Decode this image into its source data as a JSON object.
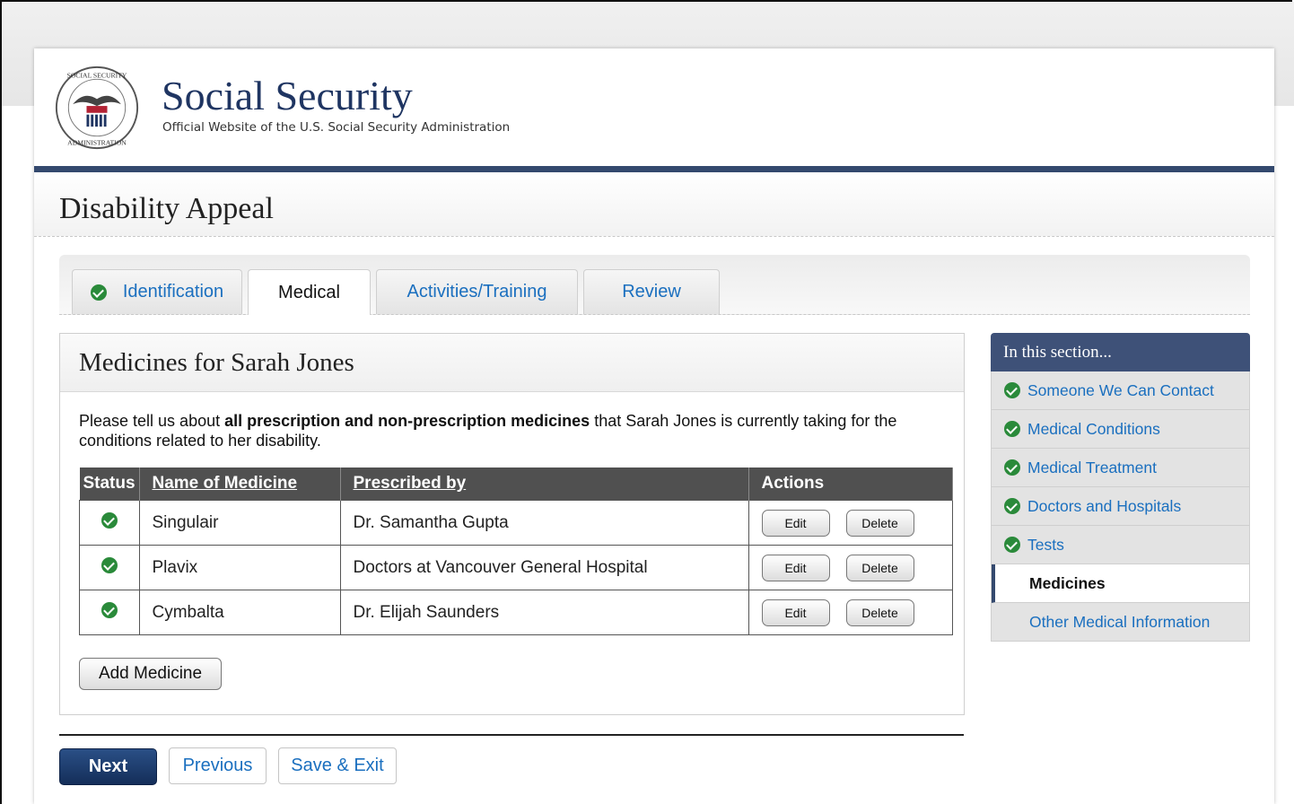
{
  "brand": {
    "title": "Social Security",
    "subtitle": "Official Website of the U.S. Social Security Administration"
  },
  "page_title": "Disability Appeal",
  "tabs": [
    {
      "label": "Identification",
      "complete": true
    },
    {
      "label": "Medical",
      "active": true
    },
    {
      "label": "Activities/Training"
    },
    {
      "label": "Review"
    }
  ],
  "panel": {
    "title": "Medicines for Sarah Jones",
    "intro_pre": "Please tell us about ",
    "intro_bold": "all prescription and non-prescription medicines",
    "intro_post": " that Sarah Jones is currently taking for the conditions related to her disability."
  },
  "table": {
    "headers": {
      "status": "Status",
      "name": "Name of Medicine",
      "prescriber": "Prescribed by",
      "actions": "Actions"
    },
    "rows": [
      {
        "name": "Singulair",
        "prescriber": "Dr. Samantha Gupta"
      },
      {
        "name": "Plavix",
        "prescriber": "Doctors at Vancouver General Hospital"
      },
      {
        "name": "Cymbalta",
        "prescriber": "Dr. Elijah Saunders"
      }
    ],
    "edit_label": "Edit",
    "delete_label": "Delete"
  },
  "add_medicine_label": "Add Medicine",
  "nav_buttons": {
    "next": "Next",
    "previous": "Previous",
    "save_exit": "Save & Exit"
  },
  "sidebar": {
    "heading": "In this section...",
    "items": [
      {
        "label": "Someone We Can Contact",
        "complete": true
      },
      {
        "label": "Medical Conditions",
        "complete": true
      },
      {
        "label": "Medical Treatment",
        "complete": true
      },
      {
        "label": "Doctors and Hospitals",
        "complete": true
      },
      {
        "label": "Tests",
        "complete": true
      },
      {
        "label": "Medicines",
        "current": true
      },
      {
        "label": "Other Medical Information"
      }
    ]
  },
  "colors": {
    "navy": "#34496e",
    "link": "#1a6fbf",
    "check": "#2a8a3a"
  }
}
